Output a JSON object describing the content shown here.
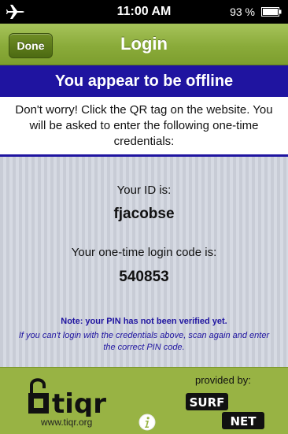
{
  "status_bar": {
    "time": "11:00 AM",
    "battery_pct": "93 %"
  },
  "nav": {
    "title": "Login",
    "done_label": "Done"
  },
  "banner": {
    "text": "You appear to be offline"
  },
  "intro": {
    "text": "Don't worry! Click the QR tag on the website. You will be asked to enter the following one-time credentials:"
  },
  "credentials": {
    "id_label": "Your ID is:",
    "id_value": "fjacobse",
    "code_label": "Your one-time login code is:",
    "code_value": "540853",
    "note": "Note: your PIN has not been verified yet.",
    "hint": "If you can't login with the credentials above, scan again and enter the correct PIN code."
  },
  "footer": {
    "logo_text": "tiqr",
    "url": "www.tiqr.org",
    "provided_by": "provided by:",
    "surfnet_top": "SURF",
    "surfnet_bottom": "NET"
  },
  "colors": {
    "accent_blue": "#1f14a0",
    "bar_green": "#8aab3a",
    "footer_green": "#98b344"
  },
  "icons": [
    "airplane-icon",
    "battery-icon",
    "info-icon"
  ]
}
